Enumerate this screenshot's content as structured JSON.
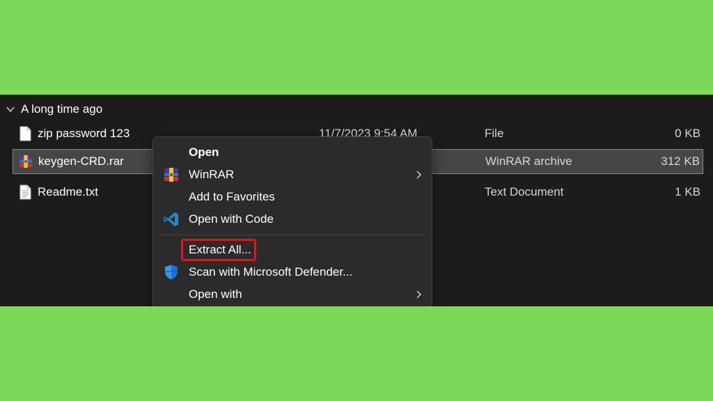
{
  "group": {
    "label": "A long time ago"
  },
  "files": [
    {
      "name": "zip password 123",
      "date": "11/7/2023 9:54 AM",
      "type": "File",
      "size": "0 KB",
      "icon": "generic-file-icon",
      "selected": false
    },
    {
      "name": "keygen-CRD.rar",
      "date": "",
      "type": "WinRAR archive",
      "size": "312 KB",
      "icon": "winrar-archive-icon",
      "selected": true
    },
    {
      "name": "Readme.txt",
      "date": "",
      "type": "Text Document",
      "size": "1 KB",
      "icon": "text-document-icon",
      "selected": false
    }
  ],
  "context_menu": {
    "items": [
      {
        "label": "Open",
        "icon": "",
        "submenu": false
      },
      {
        "label": "WinRAR",
        "icon": "winrar-icon",
        "submenu": true
      },
      {
        "label": "Add to Favorites",
        "icon": "",
        "submenu": false
      },
      {
        "label": "Open with Code",
        "icon": "vscode-icon",
        "submenu": false
      },
      {
        "label": "Extract All...",
        "icon": "",
        "submenu": false,
        "highlighted": true
      },
      {
        "label": "Scan with Microsoft Defender...",
        "icon": "defender-shield-icon",
        "submenu": false
      },
      {
        "label": "Open with",
        "icon": "",
        "submenu": true
      }
    ]
  },
  "colors": {
    "background": "#7dd85a",
    "explorer_bg": "#1c1c1c",
    "menu_bg": "#2b2b2b",
    "selection_bg": "#464646",
    "highlight_border": "#e3141d"
  }
}
